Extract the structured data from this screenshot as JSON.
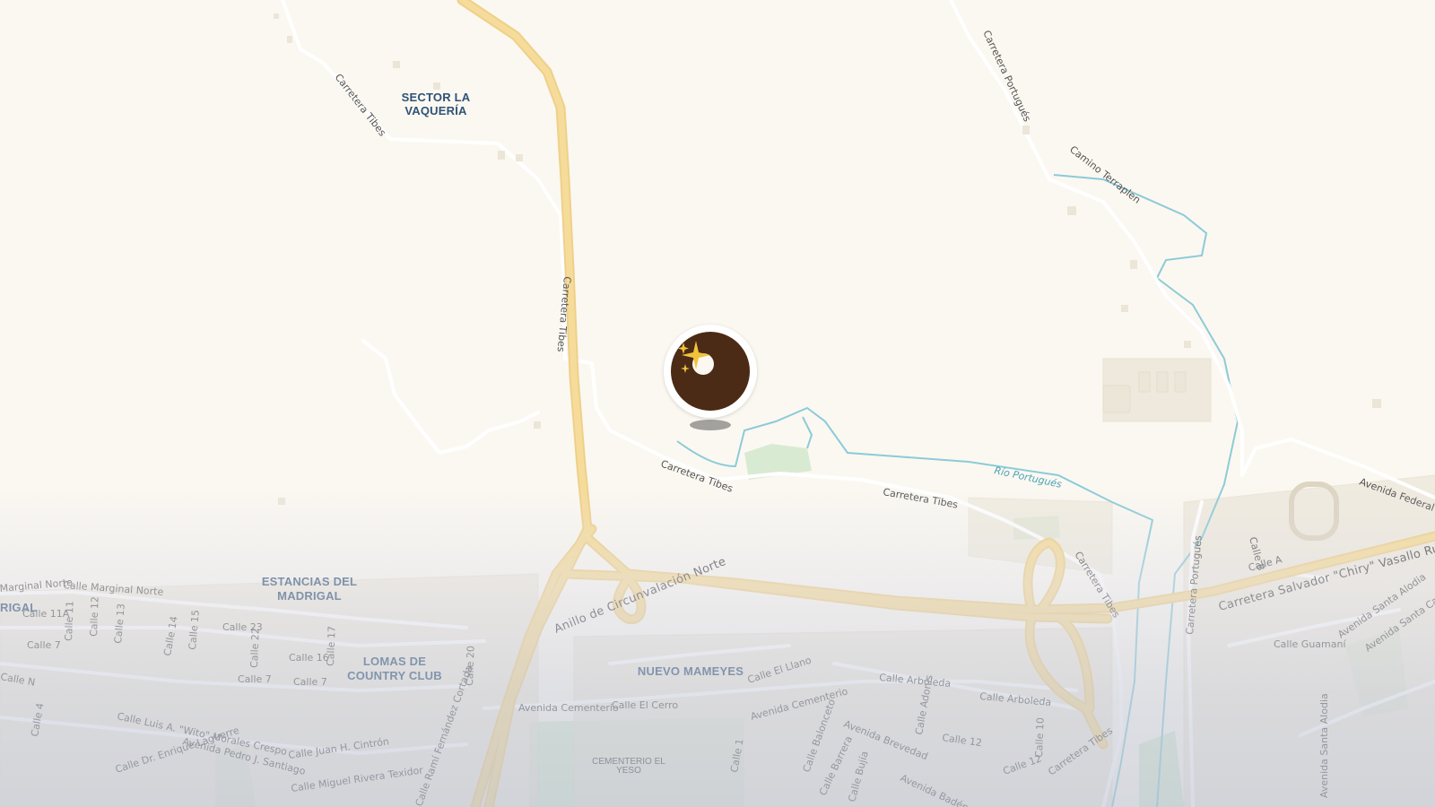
{
  "map": {
    "places": {
      "sector_la_vaqueria": [
        "SECTOR LA",
        "VAQUERÍA"
      ],
      "estancias_del_madrigal": [
        "ESTANCIAS DEL",
        "MADRIGAL"
      ],
      "lomas_de_country_club": [
        "LOMAS DE",
        "COUNTRY CLUB"
      ],
      "nuevo_mameyes": "NUEVO MAMEYES",
      "madrigal_partial": "RIGAL"
    },
    "pois": {
      "cementerio": [
        "CEMENTERIO EL",
        "YESO"
      ]
    },
    "water": {
      "rio_portugues": "Río Portugués"
    },
    "roads": {
      "carretera_tibes": "Carretera Tibes",
      "carretera_portugues": "Carretera Portugués",
      "camino_terraplen": "Camino Terraplen",
      "anillo_circunvalacion_norte": "Anillo de Circunvalación Norte",
      "carretera_salvador": "Carretera Salvador \"Chiry\" Vasallo Ruiz",
      "avenida_federal": "Avenida Federal",
      "avenida_cementerio": "Avenida Cementerio",
      "avenida_brevedad": "Avenida Brevedad",
      "avenida_baden": "Avenida Badén",
      "avenida_santa_alodia": "Avenida Santa Alodia",
      "avenida_santa_catalina": "Avenida Santa Catalina",
      "avenida_pedro": "Avenida Pedro J. Santiago",
      "calle_marginal_norte": "Calle Marginal Norte",
      "marginal_norte_partial": "Marginal Norte",
      "calle_11a": "Calle 11A",
      "calle_11": "Calle 11",
      "calle_12": "Calle 12",
      "calle_13": "Calle 13",
      "calle_14": "Calle 14",
      "calle_15": "Calle 15",
      "calle_16": "Calle 16",
      "calle_17": "Calle 17",
      "calle_20": "Calle 20",
      "calle_22": "Calle 22",
      "calle_23": "Calle 23",
      "calle_7": "Calle 7",
      "calle_7b": "Calle 7",
      "calle_7c": "Calle 7",
      "calle_n": "Calle N",
      "calle_4": "Calle 4",
      "calle_luis": "Calle Luis A. \"Wito\" Morales Crespo",
      "calle_enrique": "Calle Dr. Enrique Laguerre",
      "calle_juan": "Calle Juan H. Cintrón",
      "calle_miguel": "Calle Miguel Rivera Texidor",
      "calle_fernandez": "Calle Ramí Fernández Cortada",
      "calle_el_llano": "Calle El Llano",
      "calle_el_cerro": "Calle El Cerro",
      "calle_arboleda": "Calle Arboleda",
      "calle_arboleda2": "Calle Arboleda",
      "calle_adonis": "Calle Adonis",
      "calle_12b": "Calle 12",
      "calle_12c": "Calle 12",
      "calle_10": "Calle 10",
      "calle_1": "Calle 1",
      "calle_balonceto": "Calle Balonceto",
      "calle_barrera": "Calle Barrera",
      "calle_bujia": "Calle Bujía",
      "calle_guamani": "Calle Guamaní",
      "calle_a": "Calle A",
      "calle_b": "Calle B",
      "carretera_tibes_south": "Carretera Tibes"
    },
    "colors": {
      "land": "#fbf8f1",
      "highway": "#f6dc9a",
      "highway_casing": "#efd08a",
      "local_road": "#ffffff",
      "river": "#8ccbd8",
      "park": "#d9ead2",
      "building": "#ece6d8",
      "place_label": "#2f5277",
      "marker": "#4b2b15"
    }
  },
  "marker": {
    "icon": "donut-sparkles-icon",
    "sparkle_color": "#f1c33a"
  }
}
